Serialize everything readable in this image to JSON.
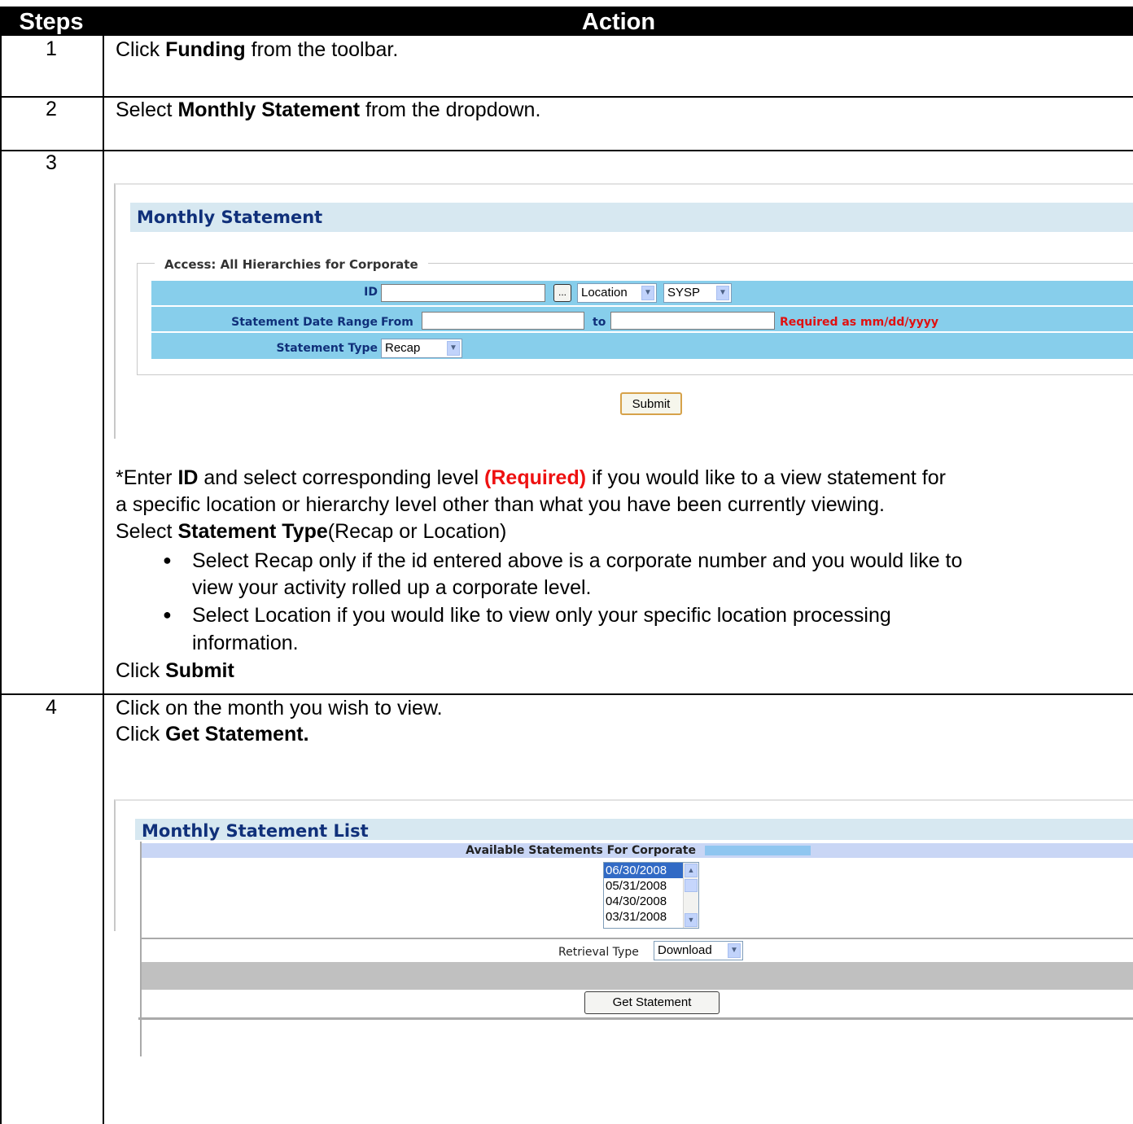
{
  "table": {
    "header": {
      "steps": "Steps",
      "action": "Action"
    },
    "rows": [
      {
        "step": "1",
        "parts": [
          "Click ",
          "Funding",
          " from the toolbar."
        ]
      },
      {
        "step": "2",
        "parts": [
          "Select ",
          "Monthly Statement",
          " from the dropdown."
        ]
      },
      {
        "step": "3",
        "line1": [
          "*Enter ",
          "ID",
          " and select corresponding level ",
          "(Required)",
          " if you would like to a view statement for"
        ],
        "line2": "a specific location or hierarchy level other than what you have been currently viewing.",
        "line3": [
          "Select ",
          "Statement Type",
          "(Recap or Location)"
        ],
        "bullet1_line1": "Select Recap only if the id entered above is a corporate number and you would like to",
        "bullet1_line2": "view your activity rolled up a corporate level.",
        "bullet2_line1": " Select Location if you would like to view only your specific location processing",
        "bullet2_line2": "information.",
        "closing": [
          "Click ",
          "Submit"
        ]
      },
      {
        "step": "4",
        "line1": "Click on the month you wish to view.",
        "line2": [
          "Click ",
          "Get Statement."
        ]
      }
    ]
  },
  "monthly_statement": {
    "title": "Monthly Statement",
    "legend": "Access: All Hierarchies for Corporate",
    "id_label": "ID",
    "id_button": "...",
    "level_select": "Location",
    "system_select": "SYSP",
    "date_range_label": "Statement Date Range",
    "from_label": "From",
    "to_label": "to",
    "date_hint": "Required as mm/dd/yyyy",
    "type_label": "Statement Type",
    "type_select": "Recap",
    "submit_label": "Submit"
  },
  "statement_list": {
    "title": "Monthly Statement List",
    "available_header": "Available Statements For Corporate",
    "dates": [
      "06/30/2008",
      "05/31/2008",
      "04/30/2008",
      "03/31/2008"
    ],
    "selected_date": "06/30/2008",
    "retrieval_label": "Retrieval Type",
    "retrieval_select": "Download",
    "get_statement_label": "Get Statement"
  },
  "colors": {
    "header_bg": "#000000",
    "panel_title_bg": "#d7e8f1",
    "form_row_bg": "#87ceeb",
    "required_red": "#ee1111"
  }
}
